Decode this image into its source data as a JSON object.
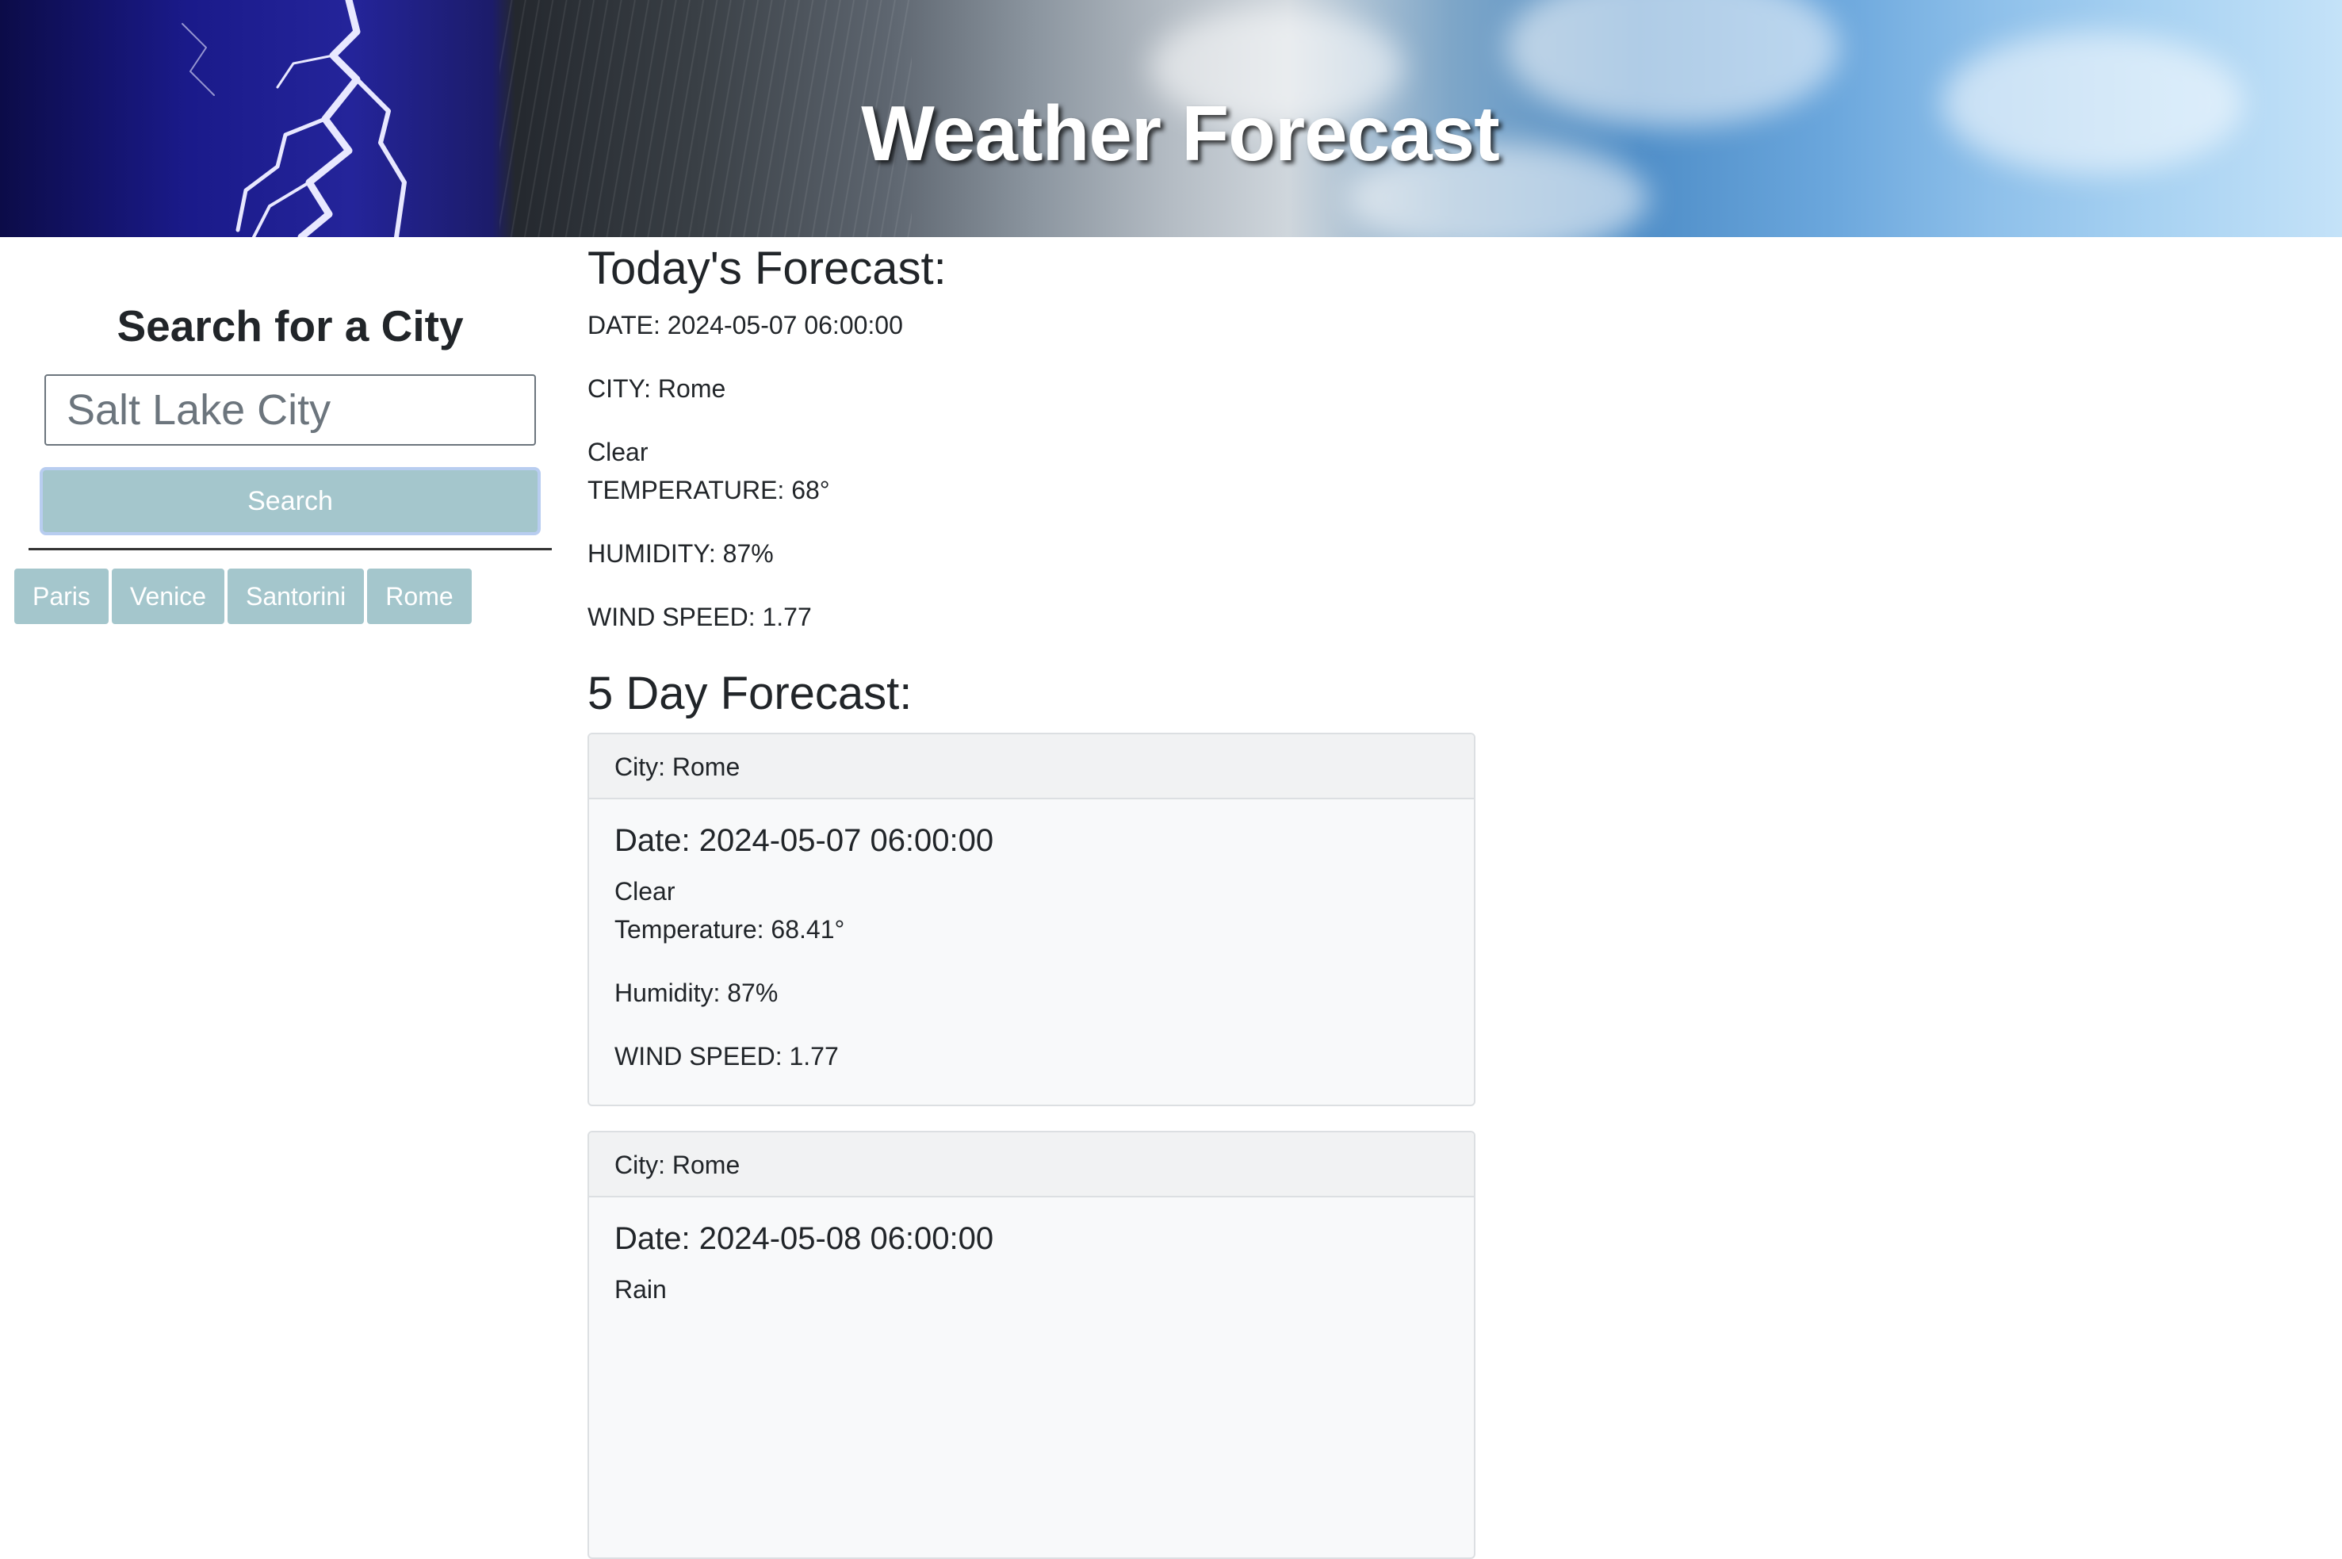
{
  "header": {
    "title": "Weather Forecast"
  },
  "sidebar": {
    "heading": "Search for a City",
    "search_placeholder": "Salt Lake City",
    "search_value": "",
    "search_button_label": "Search",
    "history": [
      "Paris",
      "Venice",
      "Santorini",
      "Rome"
    ]
  },
  "today": {
    "heading": "Today's Forecast:",
    "date": "DATE: 2024-05-07 06:00:00",
    "city": "CITY: Rome",
    "condition": "Clear",
    "temperature": "TEMPERATURE: 68°",
    "humidity": "HUMIDITY: 87%",
    "wind": "WIND SPEED: 1.77"
  },
  "five_day": {
    "heading": "5 Day Forecast:",
    "cards": [
      {
        "city": "City: Rome",
        "date": "Date: 2024-05-07 06:00:00",
        "condition": "Clear",
        "temperature": "Temperature: 68.41°",
        "humidity": "Humidity: 87%",
        "wind": "WIND SPEED: 1.77"
      },
      {
        "city": "City: Rome",
        "date": "Date: 2024-05-08 06:00:00",
        "condition": "Rain"
      }
    ]
  },
  "colors": {
    "button_bg": "#a4c6cc",
    "button_text": "#ffffff",
    "card_bg": "#f8f9fa",
    "card_header_bg": "#f1f2f3",
    "text": "#212529"
  }
}
